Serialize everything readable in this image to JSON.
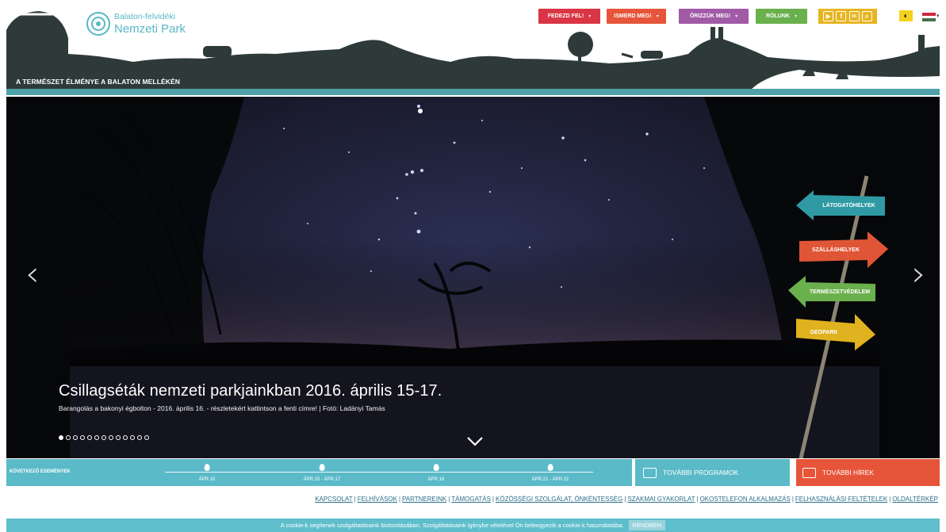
{
  "header": {
    "logo_line1": "Balaton-felvidéki",
    "logo_line2": "Nemzeti Park",
    "tagline": "A TERMÉSZET ÉLMÉNYE A BALATON MELLÉKÉN"
  },
  "nav": [
    {
      "label": "FEDEZD FEL!",
      "color": "#d93545"
    },
    {
      "label": "ISMERD MEG!",
      "color": "#e6553a"
    },
    {
      "label": "ŐRIZZÜK MEG!",
      "color": "#a05aa6"
    },
    {
      "label": "RÓLUNK",
      "color": "#6ab04c"
    }
  ],
  "social_icons": [
    "youtube-icon",
    "facebook-icon",
    "mail-icon",
    "search-icon"
  ],
  "social_color": "#e6b521",
  "hero": {
    "title": "Csillagséták nemzeti parkjainkban 2016. április 15-17.",
    "subtitle": "Barangolás a bakonyi égbolton - 2016. április 16. - részletekért kattintson a fenti címre! | Fotó: Ladányi Tamás",
    "slide_count": 13,
    "active_slide": 1
  },
  "signs": [
    {
      "label": "LÁTOGATÓHELYEK",
      "color": "#2f9aa3",
      "direction": "left"
    },
    {
      "label": "SZÁLLÁSHELYEK",
      "color": "#e05535",
      "direction": "right"
    },
    {
      "label": "TERMÉSZETVÉDELEM",
      "color": "#6ab04c",
      "direction": "left"
    },
    {
      "label": "GEOPARK",
      "color": "#e0b21f",
      "direction": "right"
    }
  ],
  "events": {
    "label": "KÖVETKEZŐ ESEMÉNYEK",
    "items": [
      "ÁPR.10",
      "ÁPR.15 - ÁPR.17",
      "ÁPR.16",
      "ÁPR.21 - ÁPR.22"
    ]
  },
  "more_programs": "TOVÁBBI PROGRAMOK",
  "more_news": "TOVÁBBI HÍREK",
  "footer_links": [
    "KAPCSOLAT",
    "FELHÍVÁSOK",
    "PARTNEREINK",
    "TÁMOGATÁS",
    "KÖZÖSSÉGI SZOLGÁLAT, ÖNKÉNTESSÉG",
    "SZAKMAI GYAKORLAT",
    "OKOSTELEFON ALKALMAZÁS",
    "FELHASZNÁLÁSI FELTÉTELEK",
    "OLDALTÉRKÉP"
  ],
  "cookie": {
    "text": "A cookie-k segítenek szolgáltatásaink biztosításában. Szolgáltatásaink igénybe vételével Ön beleegyezik a cookie-k használatába.",
    "button": "RENDBEN"
  }
}
